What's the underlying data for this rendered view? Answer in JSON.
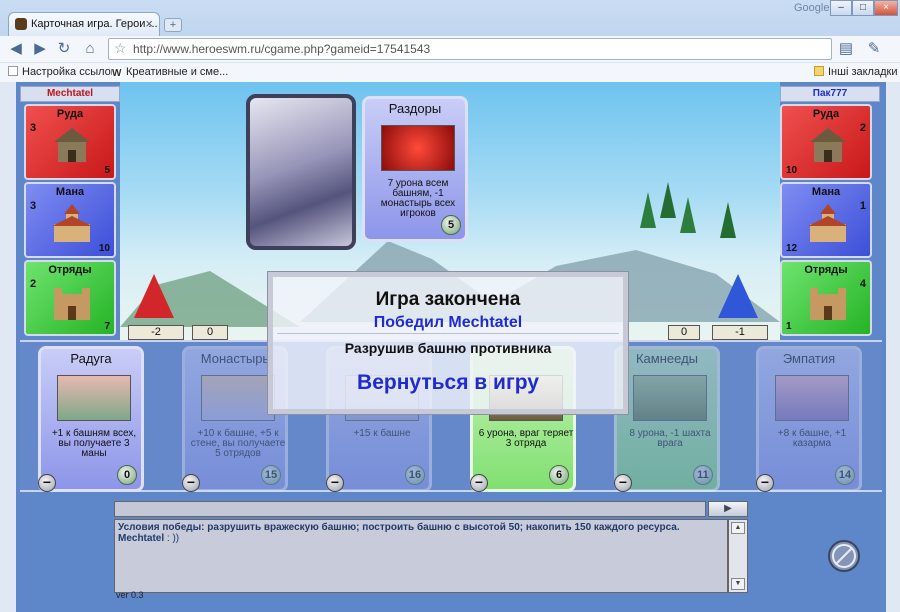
{
  "browser": {
    "tab_title": "Карточная игра. Герои ...",
    "tab_close": "×",
    "new_tab": "+",
    "brand": "Google",
    "window_controls": [
      "–",
      "□",
      "×"
    ],
    "url": "http://www.heroeswm.ru/cgame.php?gameid=17541543",
    "bookmarks": [
      "Настройка ссылок",
      "Креативные и сме..."
    ],
    "other_bookmarks": "Інші закладки"
  },
  "players": {
    "left": {
      "name": "Mechtatel",
      "resources": [
        {
          "label": "Руда",
          "count": "3",
          "production": "5",
          "color": "red"
        },
        {
          "label": "Мана",
          "count": "3",
          "production": "10",
          "color": "blue"
        },
        {
          "label": "Отряды",
          "count": "2",
          "production": "7",
          "color": "green"
        }
      ],
      "tower_change": "-2",
      "wall_change": "0"
    },
    "right": {
      "name": "Пак777",
      "resources": [
        {
          "label": "Руда",
          "count": "2",
          "production": "10",
          "color": "red"
        },
        {
          "label": "Мана",
          "count": "1",
          "production": "12",
          "color": "blue"
        },
        {
          "label": "Отряды",
          "count": "4",
          "production": "1",
          "color": "green"
        }
      ],
      "tower_change": "-1",
      "wall_change": "0"
    }
  },
  "played_card": {
    "title": "Раздоры",
    "description": "7 урона всем башням, -1 монастырь всех игроков",
    "cost": "5"
  },
  "hand": [
    {
      "title": "Радуга",
      "description": "+1 к башням всех, вы получаете 3 маны",
      "cost": "0",
      "style": "normal"
    },
    {
      "title": "Монастырь",
      "description": "+10 к башне, +5 к стене, вы получаете 5 отрядов",
      "cost": "15",
      "style": "faded"
    },
    {
      "title": "",
      "description": "+15 к башне",
      "cost": "16",
      "style": "faded"
    },
    {
      "title": "",
      "description": "6 урона, враг теряет 3 отряда",
      "cost": "6",
      "style": "green"
    },
    {
      "title": "Камнееды",
      "description": "8 урона, -1 шахта врага",
      "cost": "11",
      "style": "green-faded"
    },
    {
      "title": "Эмпатия",
      "description": "+8 к башне, +1 казарма",
      "cost": "14",
      "style": "faded"
    }
  ],
  "dialog": {
    "title": "Игра закончена",
    "winner": "Победил Mechtatel",
    "reason": "Разрушив башню противника",
    "return_link": "Вернуться в игру"
  },
  "chat": {
    "conditions": "Условия победы: разрушить вражескую башню; построить башню с высотой 50; накопить 150 каждого ресурса.",
    "message_user": "Mechtatel",
    "message_text": ": ))",
    "version": "ver 0.3"
  },
  "colors": {
    "red_panel": "#d22828",
    "blue_panel": "#3c4fd8",
    "green_panel": "#25b325",
    "accent_text": "#1f2bd0"
  }
}
